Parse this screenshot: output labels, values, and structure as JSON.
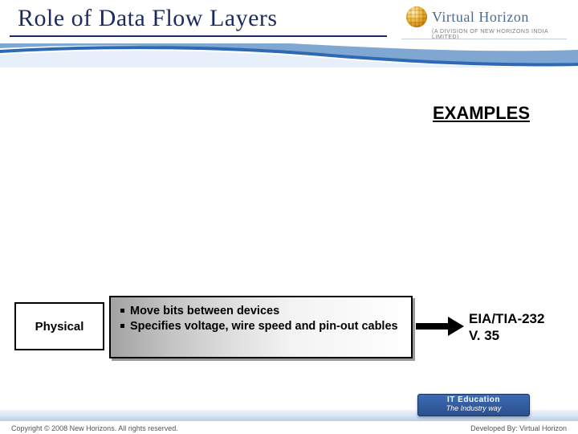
{
  "header": {
    "title": "Role of Data Flow Layers",
    "brand_name": "Virtual Horizon",
    "brand_sub": "(A DIVISION OF NEW HORIZONS INDIA LIMITED)"
  },
  "labels": {
    "examples": "EXAMPLES"
  },
  "row": {
    "layer_name": "Physical",
    "bullet1": "Move bits between devices",
    "bullet2": "Specifies voltage, wire speed and pin-out cables",
    "example_line1": "EIA/TIA-232",
    "example_line2": "V. 35"
  },
  "footer": {
    "pill_line1": "IT Education",
    "pill_line2": "The Industry way",
    "copyright": "Copyright © 2008 New Horizons. All rights reserved.",
    "developed": "Developed By: Virtual Horizon"
  }
}
